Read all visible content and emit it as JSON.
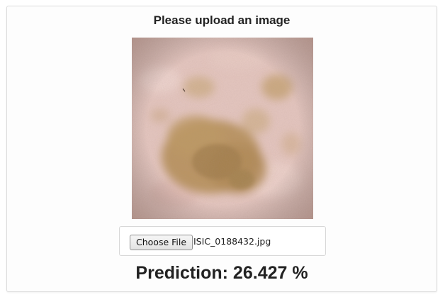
{
  "page": {
    "title": "Please upload an image"
  },
  "upload": {
    "button_label": "Choose File",
    "file_name": "ISIC_0188432.jpg"
  },
  "result": {
    "prediction_text": "Prediction: 26.427 %",
    "prediction_value": 26.427
  },
  "image": {
    "subject": "dermoscopic skin lesion image",
    "colors": {
      "skin": "#e7c9c3",
      "lesion": "#b68e55",
      "lesion_dark": "#9c7a48"
    }
  }
}
